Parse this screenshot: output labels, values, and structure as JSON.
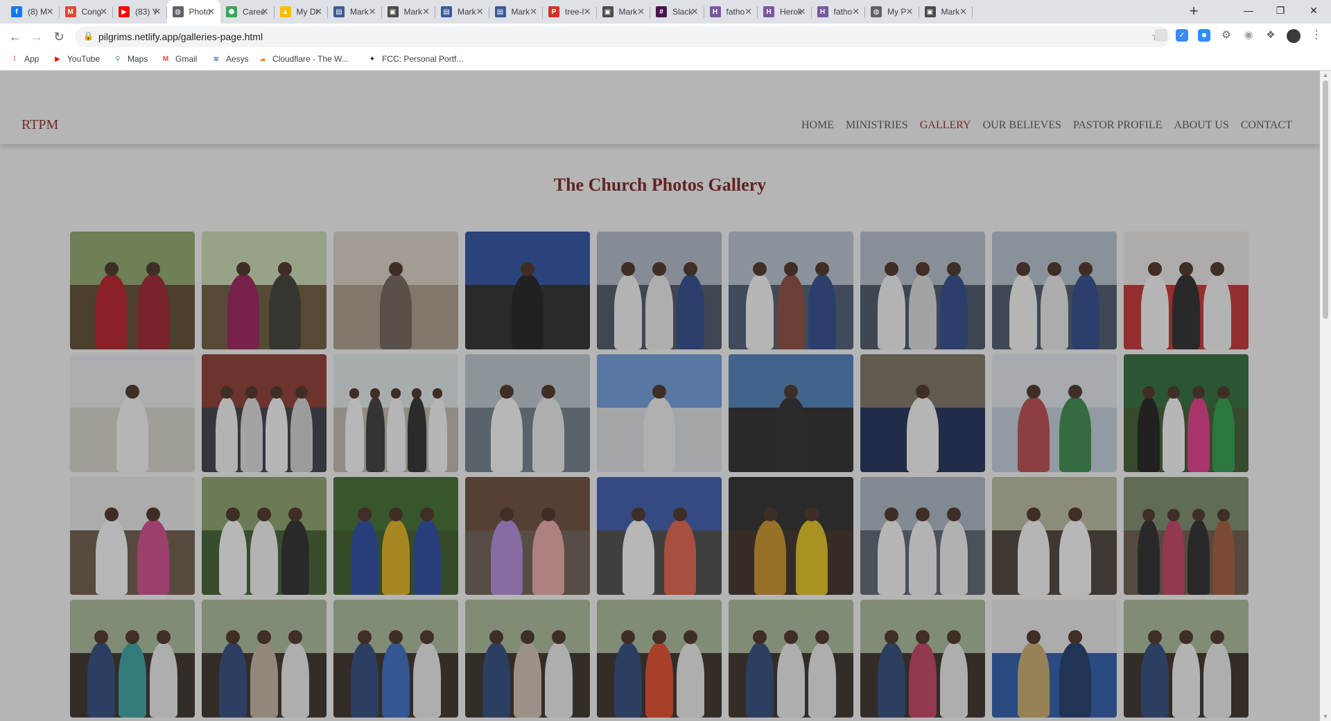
{
  "browser": {
    "tabs": [
      {
        "label": "(8) M",
        "icon": "facebook-icon",
        "color": "#1877f2",
        "glyph": "f"
      },
      {
        "label": "Cong",
        "icon": "gmail-icon",
        "color": "#ea4335",
        "glyph": "M"
      },
      {
        "label": "(83) Y",
        "icon": "youtube-icon",
        "color": "#ff0000",
        "glyph": "▶"
      },
      {
        "label": "Photo",
        "icon": "globe-icon",
        "color": "#5f6368",
        "glyph": "◍",
        "active": true
      },
      {
        "label": "Caree",
        "icon": "hexagon-icon",
        "color": "#34a853",
        "glyph": "⬢"
      },
      {
        "label": "My Dr",
        "icon": "drive-icon",
        "color": "#fbbc04",
        "glyph": "▲"
      },
      {
        "label": "Mark",
        "icon": "markdown-icon",
        "color": "#3b5998",
        "glyph": "▤"
      },
      {
        "label": "Mark",
        "icon": "page-icon",
        "color": "#4a4a4a",
        "glyph": "▣"
      },
      {
        "label": "Mark",
        "icon": "markdown-icon",
        "color": "#3b5998",
        "glyph": "▤"
      },
      {
        "label": "Mark",
        "icon": "markdown-icon",
        "color": "#3b5998",
        "glyph": "▤"
      },
      {
        "label": "tree-l",
        "icon": "pdf-icon",
        "color": "#d93025",
        "glyph": "P"
      },
      {
        "label": "Mark",
        "icon": "page-icon",
        "color": "#4a4a4a",
        "glyph": "▣"
      },
      {
        "label": "Slack",
        "icon": "slack-icon",
        "color": "#4a154b",
        "glyph": "#"
      },
      {
        "label": "fatho",
        "icon": "heroku-icon",
        "color": "#79589f",
        "glyph": "H"
      },
      {
        "label": "Herok",
        "icon": "heroku-icon",
        "color": "#79589f",
        "glyph": "H"
      },
      {
        "label": "fatho",
        "icon": "heroku-icon",
        "color": "#79589f",
        "glyph": "H"
      },
      {
        "label": "My P",
        "icon": "globe-icon",
        "color": "#5f6368",
        "glyph": "◍"
      },
      {
        "label": "Mark",
        "icon": "page-icon",
        "color": "#4a4a4a",
        "glyph": "▣"
      }
    ],
    "url": "pilgrims.netlify.app/galleries-page.html",
    "bookmarks": [
      {
        "label": "App",
        "icon": "apps-grid-icon",
        "color": "#e8453c",
        "glyph": "⁞"
      },
      {
        "label": "YouTube",
        "icon": "youtube-icon",
        "color": "#ff0000",
        "glyph": "▶"
      },
      {
        "label": "Maps",
        "icon": "maps-pin-icon",
        "color": "#34a853",
        "glyph": "⚲"
      },
      {
        "label": "Gmail",
        "icon": "gmail-icon",
        "color": "#ea4335",
        "glyph": "M"
      },
      {
        "label": "Aesys",
        "icon": "aesys-icon",
        "color": "#2b6cb0",
        "glyph": "≋"
      },
      {
        "label": "Cloudflare - The W...",
        "icon": "cloudflare-icon",
        "color": "#f48120",
        "glyph": "☁"
      },
      {
        "label": "FCC: Personal Portf...",
        "icon": "fcc-icon",
        "color": "#0a0a23",
        "glyph": "✦"
      }
    ]
  },
  "site": {
    "brand": "RTPM",
    "nav": [
      {
        "label": "HOME"
      },
      {
        "label": "MINISTRIES"
      },
      {
        "label": "GALLERY",
        "current": true
      },
      {
        "label": "OUR BELIEVES"
      },
      {
        "label": "PASTOR PROFILE"
      },
      {
        "label": "ABOUT US"
      },
      {
        "label": "CONTACT"
      }
    ],
    "gallery_title": "The Church Photos Gallery",
    "photos": [
      {
        "scene": "couple-outdoor",
        "sky": "#8da66a",
        "ground": "#5c4a2e",
        "people": [
          "#b51f2a",
          "#9c2230"
        ]
      },
      {
        "scene": "couple-under-tree",
        "sky": "#c9d7b0",
        "ground": "#6b5a3a",
        "people": [
          "#9b1f5a",
          "#3d3d35"
        ]
      },
      {
        "scene": "man-in-suit",
        "sky": "#d8cfc2",
        "ground": "#a99a88",
        "people": [
          "#6d6258"
        ]
      },
      {
        "scene": "man-on-balcony",
        "sky": "#2d4fa0",
        "ground": "#2b2b2b",
        "people": [
          "#1f1f1f"
        ]
      },
      {
        "scene": "baptism-river",
        "sky": "#aeb8c4",
        "ground": "#4b5565",
        "people": [
          "#f0f0f0",
          "#e8e8e8",
          "#2e4a8a"
        ]
      },
      {
        "scene": "baptism-river",
        "sky": "#b7c3cf",
        "ground": "#4a5a70",
        "people": [
          "#f4f4f4",
          "#8a4a3a",
          "#2e4a8a"
        ]
      },
      {
        "scene": "baptism-river",
        "sky": "#b2bcc8",
        "ground": "#485468",
        "people": [
          "#f0f0f0",
          "#d9d9d9",
          "#2e4a8a"
        ]
      },
      {
        "scene": "baptism-river",
        "sky": "#b5c0cb",
        "ground": "#495669",
        "people": [
          "#f2f2f2",
          "#e6e6e6",
          "#2e4a8a"
        ]
      },
      {
        "scene": "church-wedding",
        "sky": "#e8e6e2",
        "ground": "#c23232",
        "people": [
          "#f4f4f4",
          "#2a2a2a",
          "#f0f0f0"
        ]
      },
      {
        "scene": "portrait-man",
        "sky": "#e7e9ec",
        "ground": "#d5d1c8",
        "people": [
          "#f3f3f3"
        ]
      },
      {
        "scene": "congregation",
        "sky": "#8a3a30",
        "ground": "#3c3c48",
        "people": [
          "#f0f0f0",
          "#d8d8d8",
          "#f4f4f4",
          "#cfcfcf"
        ]
      },
      {
        "scene": "beach-group",
        "sky": "#dfe6ea",
        "ground": "#bfb7a8",
        "people": [
          "#f5f5f5",
          "#3a3a3a",
          "#f2f2f2",
          "#2d2d2d",
          "#f4f4f4"
        ]
      },
      {
        "scene": "sea-baptism",
        "sky": "#b9c4cc",
        "ground": "#6f7d88",
        "people": [
          "#f5f5f5",
          "#e9e9e9"
        ]
      },
      {
        "scene": "woman-floral-dress",
        "sky": "#6d9ad8",
        "ground": "#d8dde0",
        "people": [
          "#eaeaea"
        ]
      },
      {
        "scene": "woman-black-dress",
        "sky": "#4c7eb8",
        "ground": "#2a2a2a",
        "people": [
          "#2c2c2c"
        ]
      },
      {
        "scene": "woman-tree",
        "sky": "#7a7261",
        "ground": "#1f2e58",
        "people": [
          "#f2f2f2"
        ]
      },
      {
        "scene": "women-chairs",
        "sky": "#dfe2ea",
        "ground": "#c0ccd8",
        "people": [
          "#b84a4a",
          "#3a8a4a"
        ]
      },
      {
        "scene": "wedding-party",
        "sky": "#2f6a38",
        "ground": "#3d5a2e",
        "people": [
          "#1f1f1f",
          "#f4f4f4",
          "#e03a8a",
          "#2f9a4a"
        ]
      },
      {
        "scene": "signing-book",
        "sky": "#e6e6e6",
        "ground": "#6a5a4a",
        "people": [
          "#f5f5f5",
          "#d04a8a"
        ]
      },
      {
        "scene": "wedding-couple",
        "sky": "#8aa06a",
        "ground": "#3f5d2e",
        "people": [
          "#f5f5f5",
          "#f0f0f0",
          "#2a2a2a"
        ]
      },
      {
        "scene": "garden-group",
        "sky": "#3f6a2f",
        "ground": "#3b5a28",
        "people": [
          "#2a4aa0",
          "#e0b020",
          "#2a4aa0"
        ]
      },
      {
        "scene": "couple-indoor",
        "sky": "#6a4a3a",
        "ground": "#6b5d52",
        "people": [
          "#b08ad8",
          "#e8a8a8"
        ]
      },
      {
        "scene": "couple-blue-room",
        "sky": "#3c5aa8",
        "ground": "#4a4a4a",
        "people": [
          "#f5f5f5",
          "#e0604a"
        ]
      },
      {
        "scene": "couple-african-print",
        "sky": "#2c2c2c",
        "ground": "#3a2e25",
        "people": [
          "#c8902a",
          "#e0c020"
        ]
      },
      {
        "scene": "church-interior",
        "sky": "#a8b4c0",
        "ground": "#5a6470",
        "people": [
          "#f4f4f4",
          "#f0f0f0",
          "#ececec"
        ]
      },
      {
        "scene": "river-baptism",
        "sky": "#b8b8a0",
        "ground": "#4a4038",
        "people": [
          "#f2f2f2",
          "#f5f5f5"
        ]
      },
      {
        "scene": "large-group",
        "sky": "#7a8a6a",
        "ground": "#6a5a4a",
        "people": [
          "#2a2a2a",
          "#c04060",
          "#2a2a2a",
          "#a05a3a"
        ]
      },
      {
        "scene": "river-baptism",
        "sky": "#a8b898",
        "ground": "#3a2e28",
        "people": [
          "#2e4a7a",
          "#3aa0a0",
          "#e8e8e8"
        ]
      },
      {
        "scene": "river-baptism",
        "sky": "#a8b898",
        "ground": "#3a2e28",
        "people": [
          "#2e4a7a",
          "#c0b0a0",
          "#e8e8e8"
        ]
      },
      {
        "scene": "river-baptism",
        "sky": "#a8b898",
        "ground": "#3a2e28",
        "people": [
          "#2e4a7a",
          "#3a6ac0",
          "#e8e8e8"
        ]
      },
      {
        "scene": "river-baptism",
        "sky": "#a8b898",
        "ground": "#3a2e28",
        "people": [
          "#2e4a7a",
          "#d0c0b0",
          "#e8e8e8"
        ]
      },
      {
        "scene": "river-baptism",
        "sky": "#a8b898",
        "ground": "#3a2e28",
        "people": [
          "#2e4a7a",
          "#e04a2a",
          "#e8e8e8"
        ]
      },
      {
        "scene": "river-baptism",
        "sky": "#a8b898",
        "ground": "#3a2e28",
        "people": [
          "#2e4a7a",
          "#e8e8e8",
          "#e8e8e8"
        ]
      },
      {
        "scene": "river-baptism",
        "sky": "#a8b898",
        "ground": "#3a2e28",
        "people": [
          "#2e4a7a",
          "#c04060",
          "#e8e8e8"
        ]
      },
      {
        "scene": "couple-blue-wall",
        "sky": "#e6e6e6",
        "ground": "#2c5aa8",
        "people": [
          "#c8a86a",
          "#1f3a6a"
        ]
      },
      {
        "scene": "river-baptism",
        "sky": "#a8b898",
        "ground": "#3a2e28",
        "people": [
          "#2e4a7a",
          "#f0f0f0",
          "#e8e8e8"
        ]
      }
    ]
  }
}
